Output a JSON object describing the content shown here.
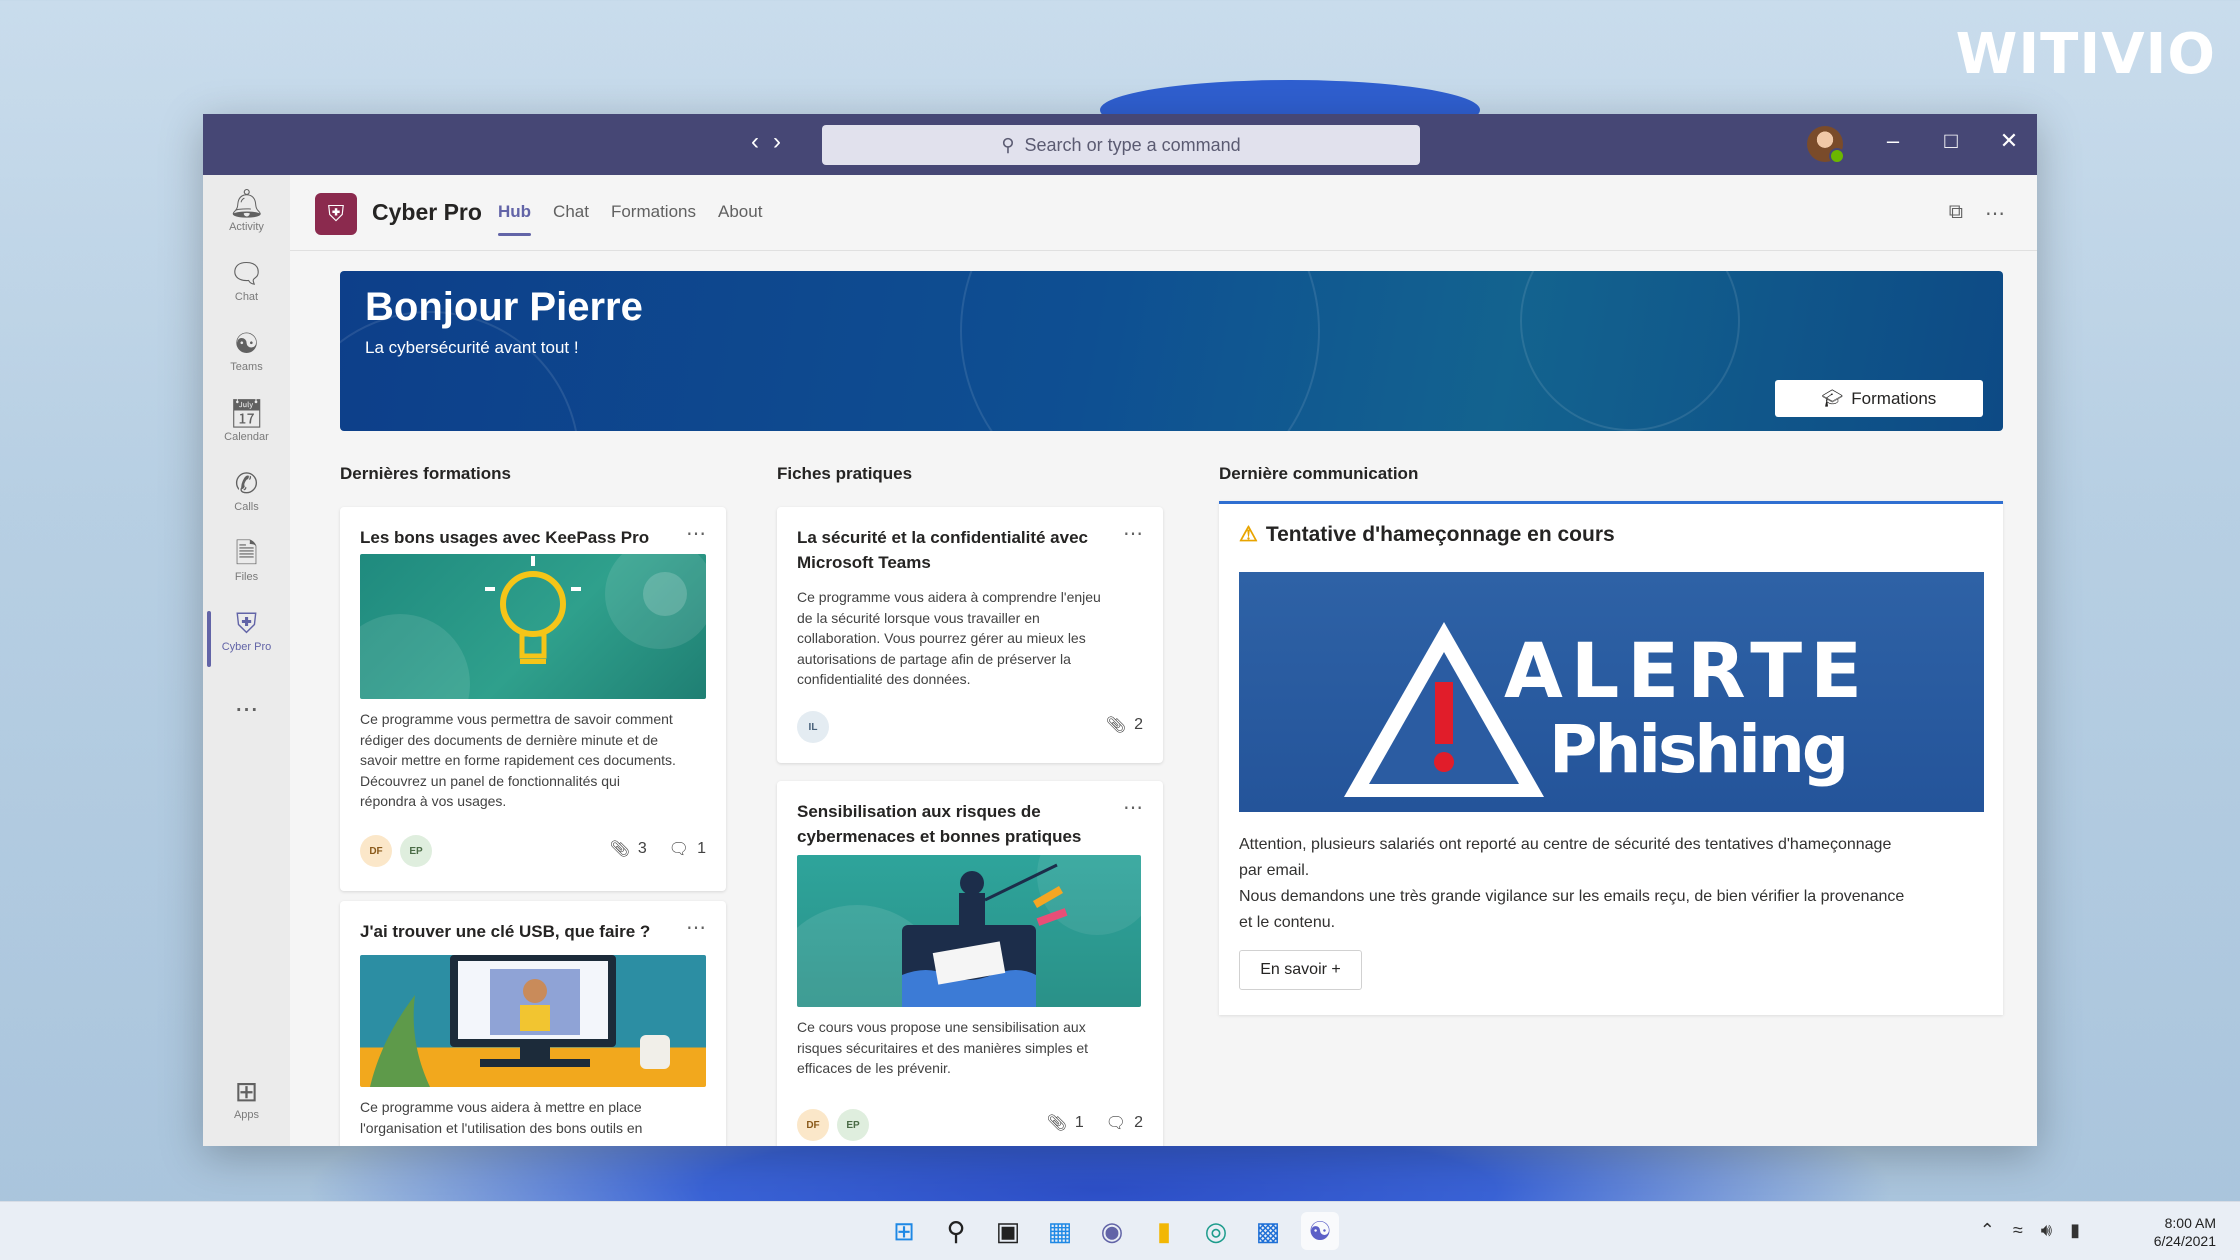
{
  "brand": "WITIVIO",
  "titlebar": {
    "search_placeholder": "Search or type a command",
    "back_icon": "chevron-left-icon",
    "forward_icon": "chevron-right-icon"
  },
  "rail": {
    "items": [
      {
        "label": "Activity",
        "icon": "bell-icon"
      },
      {
        "label": "Chat",
        "icon": "chat-icon"
      },
      {
        "label": "Teams",
        "icon": "teams-icon"
      },
      {
        "label": "Calendar",
        "icon": "calendar-icon"
      },
      {
        "label": "Calls",
        "icon": "phone-icon"
      },
      {
        "label": "Files",
        "icon": "file-icon"
      },
      {
        "label": "Cyber Pro",
        "icon": "shield-icon"
      },
      {
        "label": "Apps",
        "icon": "apps-icon"
      }
    ],
    "more": "..."
  },
  "app": {
    "name": "Cyber Pro",
    "tabs": [
      "Hub",
      "Chat",
      "Formations",
      "About"
    ],
    "active_tab": "Hub"
  },
  "hero": {
    "title": "Bonjour Pierre",
    "subtitle": "La cybersécurité avant tout !",
    "button": "Formations"
  },
  "sections": {
    "formations": "Dernières formations",
    "fiches": "Fiches pratiques",
    "communication": "Dernière communication"
  },
  "formations": [
    {
      "title": "Les bons usages avec KeePass Pro",
      "body": [
        "Ce programme vous permettra de savoir comment",
        "rédiger des documents de dernière minute et de",
        "savoir mettre en forme rapidement ces documents.",
        "Découvrez un panel de fonctionnalités qui",
        "répondra à vos usages."
      ],
      "chips": [
        "DF",
        "EP"
      ],
      "attachments": "3",
      "comments": "1"
    },
    {
      "title": "J'ai trouver une clé USB, que faire ?",
      "body": [
        "Ce programme vous aidera à mettre en place",
        "l'organisation et l'utilisation des bons outils en"
      ]
    }
  ],
  "fiches": [
    {
      "title": [
        "La sécurité et la confidentialité avec",
        "Microsoft Teams"
      ],
      "body": [
        "Ce programme vous aidera à comprendre l'enjeu",
        "de la sécurité lorsque vous travailler en",
        "collaboration. Vous pourrez gérer au mieux les",
        "autorisations de partage afin de préserver la",
        "confidentialité des données."
      ],
      "chips": [
        "IL"
      ],
      "attachments": "2"
    },
    {
      "title": [
        "Sensibilisation aux risques de",
        "cybermenaces et bonnes pratiques"
      ],
      "body": [
        "Ce cours vous propose une sensibilisation aux",
        "risques sécuritaires et des manières simples et",
        "efficaces de les prévenir."
      ],
      "chips": [
        "DF",
        "EP"
      ],
      "attachments": "1",
      "comments": "2"
    }
  ],
  "communication": {
    "title": "Tentative d'hameçonnage en cours",
    "alert_word": "ALERTE",
    "alert_sub": "Phishing",
    "text": [
      "Attention, plusieurs salariés ont reporté au centre de sécurité des tentatives d'hameçonnage",
      "par email.",
      "Nous demandons une très grande vigilance sur les emails reçu, de bien vérifier la provenance",
      "et le contenu."
    ],
    "button": "En savoir +"
  },
  "taskbar": {
    "time": "8:00 AM",
    "date": "6/24/2021"
  },
  "colors": {
    "titlebar": "#464775",
    "accent": "#6264a7",
    "hero": "#0e4f92",
    "app_logo": "#8b2a4e"
  }
}
